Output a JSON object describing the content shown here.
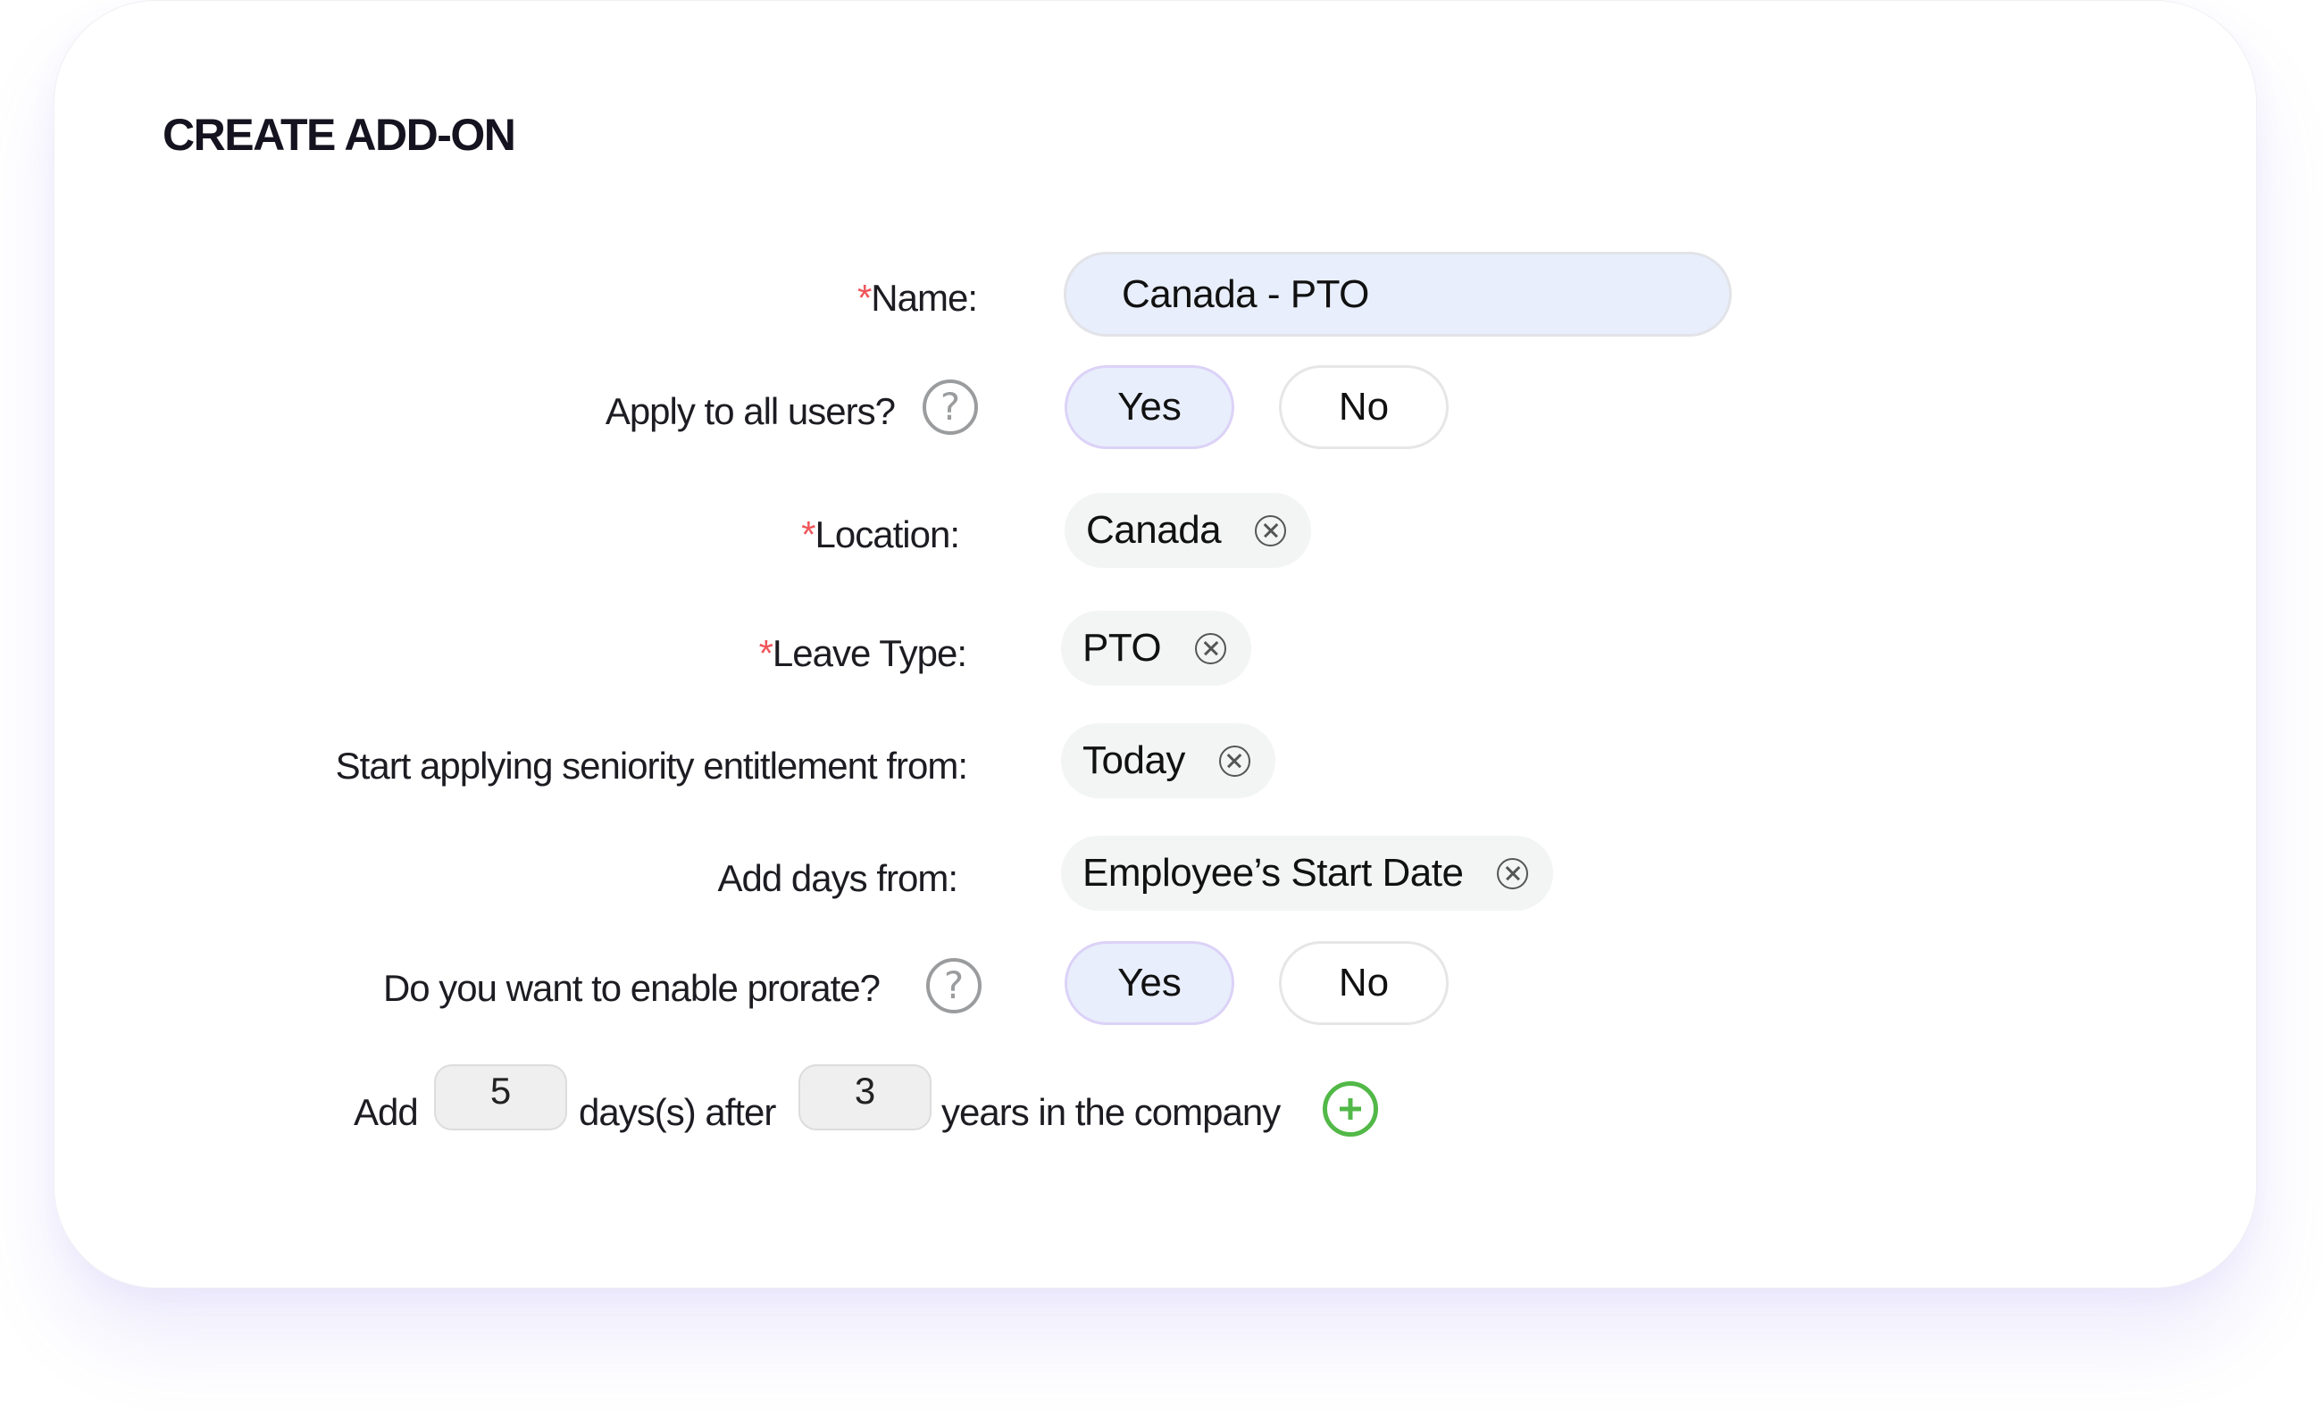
{
  "page": {
    "title": "CREATE ADD-ON"
  },
  "form": {
    "required_marker": "*",
    "help_glyph": "?",
    "name": {
      "label": "Name:",
      "required": true,
      "value": "Canada - PTO"
    },
    "apply_to_all_users": {
      "label": "Apply to all users?",
      "has_help": true,
      "options": [
        {
          "label": "Yes",
          "selected": true
        },
        {
          "label": "No",
          "selected": false
        }
      ]
    },
    "location": {
      "label": "Location:",
      "required": true,
      "value": "Canada"
    },
    "leave_type": {
      "label": "Leave Type:",
      "required": true,
      "value": "PTO"
    },
    "seniority_start": {
      "label": "Start applying seniority entitlement from:",
      "value": "Today"
    },
    "add_days_from": {
      "label": "Add days from:",
      "value": "Employee’s Start Date"
    },
    "prorate": {
      "label": "Do you want to enable prorate?",
      "has_help": true,
      "options": [
        {
          "label": "Yes",
          "selected": true
        },
        {
          "label": "No",
          "selected": false
        }
      ]
    },
    "rule": {
      "prefix": "Add",
      "days_value": "5",
      "middle": "days(s) after",
      "years_value": "3",
      "suffix": "years in the company",
      "add_rule_icon": "plus-circle-icon"
    }
  },
  "icons": {
    "help": "question-circle-icon",
    "remove": "close-circle-icon",
    "add": "plus-circle-icon"
  },
  "colors": {
    "required": "#f0555a",
    "selected_bg": "#e8eefb",
    "selected_border": "#dcd2f7",
    "chip_bg": "#f3f4f4",
    "add_icon": "#52b848",
    "help_icon": "#9a9c9e"
  }
}
